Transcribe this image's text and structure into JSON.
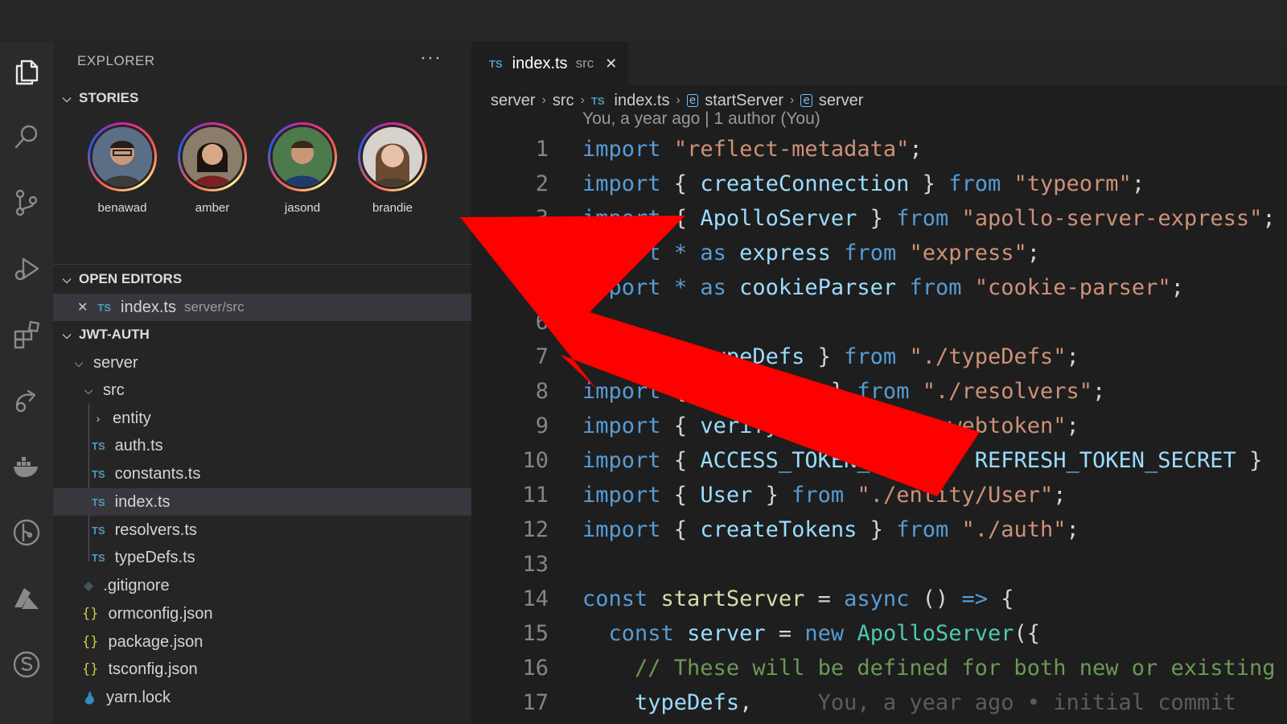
{
  "explorer": {
    "title": "EXPLORER",
    "more": "···",
    "stories_section": "STORIES",
    "stories": [
      {
        "name": "benawad"
      },
      {
        "name": "amber"
      },
      {
        "name": "jasond"
      },
      {
        "name": "brandie"
      }
    ],
    "open_editors_section": "OPEN EDITORS",
    "open_editor": {
      "name": "index.ts",
      "path": "server/src",
      "close": "✕",
      "badge": "TS"
    },
    "project_section": "JWT-AUTH",
    "tree": {
      "server": "server",
      "src": "src",
      "entity": "entity",
      "files_ts": [
        {
          "name": "auth.ts",
          "badge": "TS"
        },
        {
          "name": "constants.ts",
          "badge": "TS"
        },
        {
          "name": "index.ts",
          "badge": "TS"
        },
        {
          "name": "resolvers.ts",
          "badge": "TS"
        },
        {
          "name": "typeDefs.ts",
          "badge": "TS"
        }
      ],
      "root_files": [
        {
          "name": ".gitignore",
          "icon": "◆"
        },
        {
          "name": "ormconfig.json",
          "icon": "{}"
        },
        {
          "name": "package.json",
          "icon": "{}"
        },
        {
          "name": "tsconfig.json",
          "icon": "{}"
        },
        {
          "name": "yarn.lock",
          "icon": "yarn-icon"
        }
      ]
    }
  },
  "editor": {
    "tab": {
      "badge": "TS",
      "name": "index.ts",
      "desc": "src",
      "close": "✕"
    },
    "breadcrumb": {
      "parts": [
        "server",
        "src",
        "index.ts",
        "startServer",
        "server"
      ],
      "file_badge": "TS",
      "sep": "›"
    },
    "codelens": "You, a year ago | 1 author (You)",
    "line_numbers": [
      "1",
      "2",
      "3",
      "4",
      "5",
      "6",
      "7",
      "8",
      "9",
      "10",
      "11",
      "12",
      "13",
      "14",
      "15",
      "16",
      "17"
    ],
    "blame": "You, a year ago • initial commit"
  },
  "colors": {
    "accent_red": "#ff0000",
    "ts_blue": "#519aba",
    "keyword": "#569cd6",
    "string": "#ce9178"
  }
}
